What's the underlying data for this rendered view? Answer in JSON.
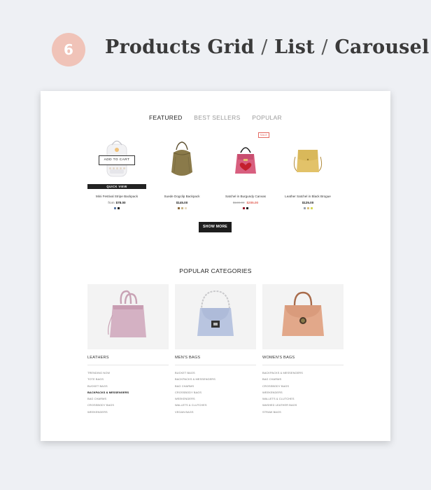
{
  "header": {
    "step_number": "6",
    "title_parts": [
      "Products Grid",
      "List",
      "Carousel"
    ],
    "separator": "/"
  },
  "tabs": [
    {
      "label": "FEATURED",
      "active": true
    },
    {
      "label": "BEST SELLERS",
      "active": false
    },
    {
      "label": "POPULAR",
      "active": false
    }
  ],
  "products": [
    {
      "name": "Mini Festival Stripe Backpack",
      "price_prefix": "from",
      "price": "$78.00",
      "old_price": "",
      "add_to_cart_label": "ADD TO CART",
      "quick_view_label": "QUICK VIEW",
      "swatches": [
        "#5b7ba8",
        "#222222"
      ]
    },
    {
      "name": "Suede Dogclip Backpack",
      "price": "$145.00",
      "swatches": [
        "#8b6a3e",
        "#c8b48a",
        "#e8dcc5"
      ]
    },
    {
      "name": "Satchel in Burgundy Canvas",
      "old_price": "$180.00",
      "price": "$205.00",
      "sale_label": "SALE",
      "swatches": [
        "#9b1c2e",
        "#222222"
      ]
    },
    {
      "name": "Leather Satchel in Black Brogue",
      "price": "$125.00",
      "swatches": [
        "#9aa3b0",
        "#d9c07a",
        "#d6d957"
      ]
    }
  ],
  "show_more_label": "SHOW MORE",
  "popular": {
    "title": "POPULAR CATEGORIES",
    "categories": [
      {
        "name": "LEATHERS",
        "links": [
          {
            "label": "TRENDING NOW"
          },
          {
            "label": "TOTE BAGS"
          },
          {
            "label": "BUCKET BAGS"
          },
          {
            "label": "BACKPACKS & MESSENGERS",
            "bold": true
          },
          {
            "label": "BAG CHARMS"
          },
          {
            "label": "CROSSBODY BAGS"
          },
          {
            "label": "WEEKENDERS"
          }
        ]
      },
      {
        "name": "MEN'S BAGS",
        "links": [
          {
            "label": "BUCKET BAGS"
          },
          {
            "label": "BACKPACKS & MESSENGERS"
          },
          {
            "label": "BAG CHARMS"
          },
          {
            "label": "CROSSBODY BAGS"
          },
          {
            "label": "WEEKENDERS"
          },
          {
            "label": "WALLETS & CLUTCHES"
          },
          {
            "label": "VEGAN BAGS"
          }
        ]
      },
      {
        "name": "WOMEN'S BAGS",
        "links": [
          {
            "label": "BACKPACKS & MESSENGERS"
          },
          {
            "label": "BAG CHARMS"
          },
          {
            "label": "CROSSBODY BAGS"
          },
          {
            "label": "WEEKENDERS"
          },
          {
            "label": "WALLETS & CLUTCHES"
          },
          {
            "label": "WASHED LEATHER BAGS"
          },
          {
            "label": "STRAW BAGS"
          }
        ]
      }
    ]
  },
  "colors": {
    "badge": "#f0c3b8",
    "sale": "#e46a62",
    "button": "#1d1d1d"
  }
}
